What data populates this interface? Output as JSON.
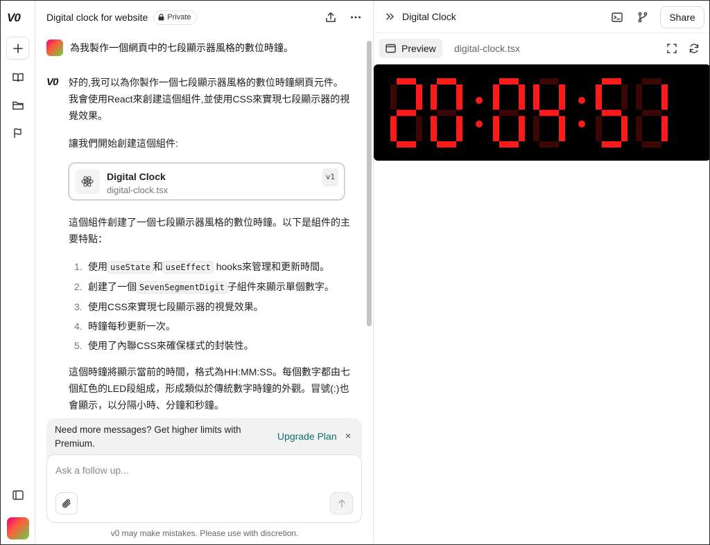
{
  "rail": {
    "logo": "V0"
  },
  "chat": {
    "title": "Digital clock for website",
    "private_label": "Private",
    "user_message": "為我製作一個網頁中的七段顯示器風格的數位時鐘。",
    "bot_logo": "V0",
    "intro": "好的,我可以為你製作一個七段顯示器風格的數位時鐘網頁元件。我會使用React來創建這個組件,並使用CSS來實現七段顯示器的視覺效果。",
    "lead": "讓我們開始創建這個組件:",
    "artifact": {
      "title": "Digital Clock",
      "file": "digital-clock.tsx",
      "version": "v1"
    },
    "features_intro": "這個組件創建了一個七段顯示器風格的數位時鐘。以下是組件的主要特點：",
    "features": [
      {
        "num": "1.",
        "pre": "使用",
        "code1": "useState",
        "mid": "和",
        "code2": "useEffect",
        "post": " hooks來管理和更新時間。"
      },
      {
        "num": "2.",
        "pre": "創建了一個",
        "code1": "SevenSegmentDigit",
        "post": "子組件來顯示單個數字。"
      },
      {
        "num": "3.",
        "text": "使用CSS來實現七段顯示器的視覺效果。"
      },
      {
        "num": "4.",
        "text": "時鐘每秒更新一次。"
      },
      {
        "num": "5.",
        "text": "使用了內聯CSS來確保樣式的封裝性。"
      }
    ],
    "summary": "這個時鐘將顯示當前的時間，格式為HH:MM:SS。每個數字都由七個紅色的LED段組成，形成類似於傳統數字時鐘的外觀。冒號(:)也會顯示，以分隔小時、分鐘和秒鐘。",
    "upgrade_text": "Need more messages? Get higher limits with Premium.",
    "upgrade_link": "Upgrade Plan",
    "upgrade_close": "×",
    "composer_placeholder": "Ask a follow up...",
    "disclaimer": "v0 may make mistakes. Please use with discretion."
  },
  "preview": {
    "title": "Digital Clock",
    "share_label": "Share",
    "tab_preview": "Preview",
    "tab_code": "digital-clock.tsx",
    "time": "20:04:51",
    "on_color": "#ff1a1a",
    "off_color": "#3a0606"
  }
}
